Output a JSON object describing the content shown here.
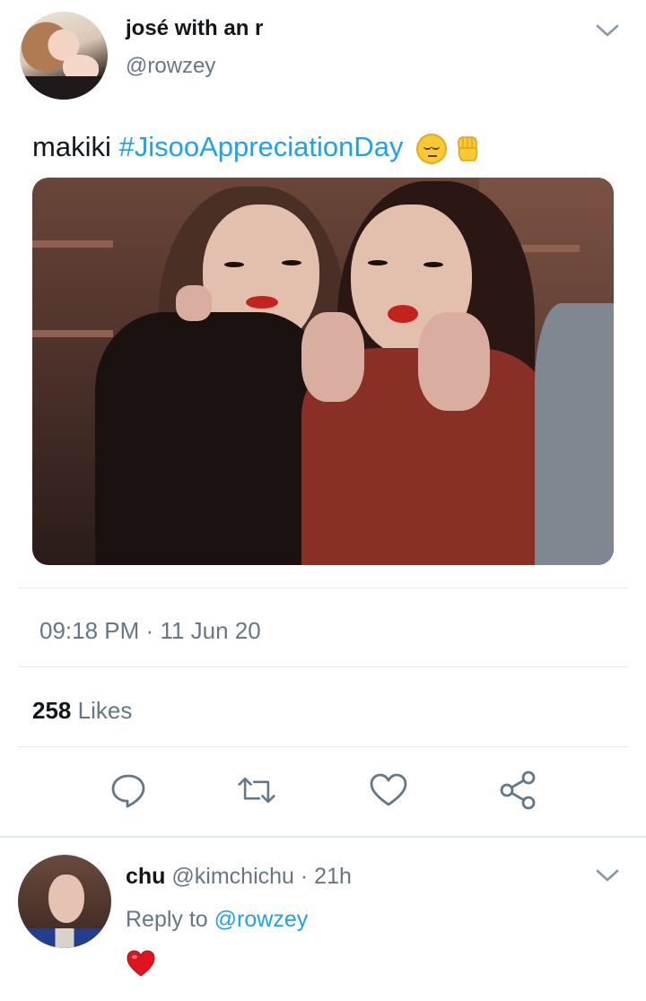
{
  "tweet": {
    "author_name": "josé with an r",
    "author_handle": "@rowzey",
    "text_plain": "makiki ",
    "hashtag": "#JisooAppreciationDay",
    "emojis": [
      "pensive-face-emoji",
      "raised-fist-emoji"
    ],
    "image_alt": "photo of two women making heart signs",
    "time": "09:18 PM",
    "separator": "·",
    "date": "11 Jun 20",
    "likes_count": "258",
    "likes_label": "Likes",
    "actions": [
      "reply-icon",
      "retweet-icon",
      "like-icon",
      "share-icon"
    ]
  },
  "reply": {
    "author_name": "chu",
    "author_handle": "@kimchichu",
    "age": "· 21h",
    "reply_prefix": "Reply to",
    "reply_mention": "@rowzey",
    "content_emoji": "red-heart-emoji"
  },
  "colors": {
    "link": "#1da1f2",
    "secondary_text": "#657786",
    "primary_text": "#14171a",
    "divider": "#e1e8ed"
  }
}
